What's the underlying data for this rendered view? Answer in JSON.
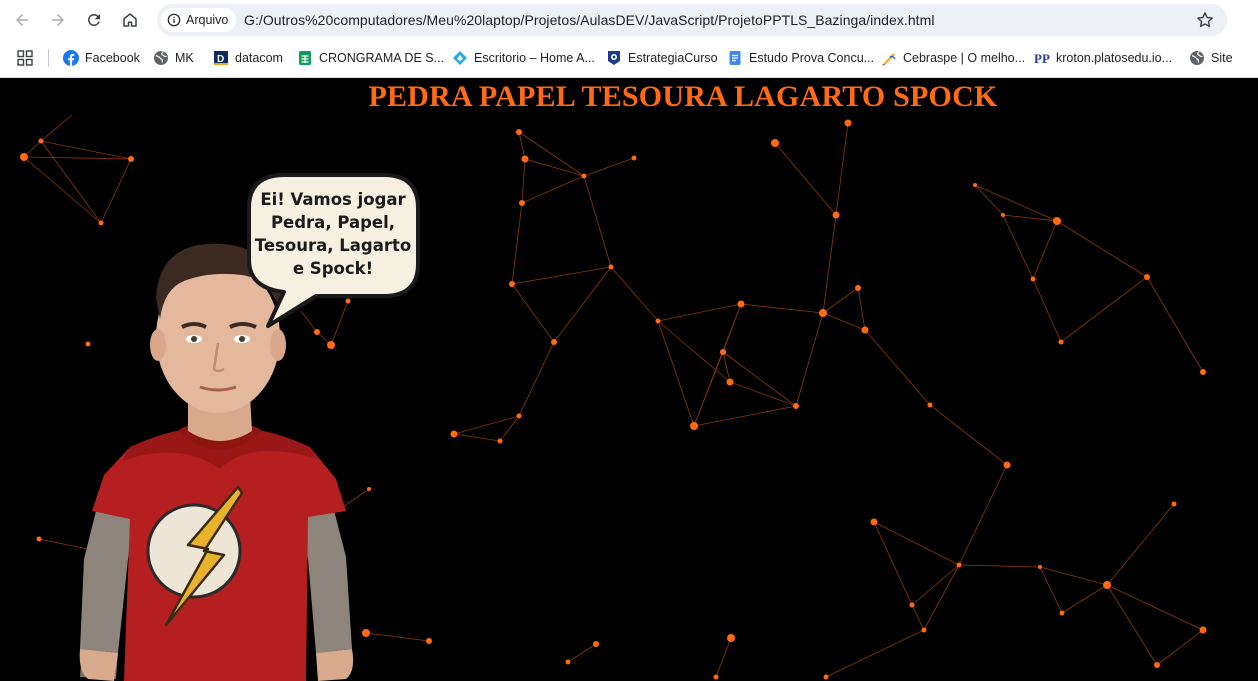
{
  "browser": {
    "chip_label": "Arquivo",
    "url": "G:/Outros%20computadores/Meu%20laptop/Projetos/AulasDEV/JavaScript/ProjetoPPTLS_Bazinga/index.html",
    "bookmarks": [
      {
        "label": "Facebook",
        "icon": "facebook-icon"
      },
      {
        "label": "MK",
        "icon": "globe-icon"
      },
      {
        "label": "datacom",
        "icon": "datacom-icon"
      },
      {
        "label": "CRONGRAMA DE S...",
        "icon": "sheets-icon"
      },
      {
        "label": "Escritorio – Home A...",
        "icon": "escritorio-icon"
      },
      {
        "label": "EstrategiaCurso",
        "icon": "estrategia-icon"
      },
      {
        "label": "Estudo Prova Concu...",
        "icon": "docs-icon"
      },
      {
        "label": "Cebraspe | O melho...",
        "icon": "cebraspe-icon"
      },
      {
        "label": "kroton.platosedu.io...",
        "icon": "kroton-icon"
      },
      {
        "label": "Site",
        "icon": "globe-icon"
      }
    ]
  },
  "page": {
    "title": "PEDRA PAPEL TESOURA LAGARTO SPOCK",
    "speech": {
      "line1": "Ei! Vamos jogar",
      "line2": "Pedra, Papel,",
      "line3": "Tesoura, Lagarto",
      "line4": "e Spock!"
    },
    "accent_color": "#ff6a13",
    "background_color": "#000000"
  }
}
